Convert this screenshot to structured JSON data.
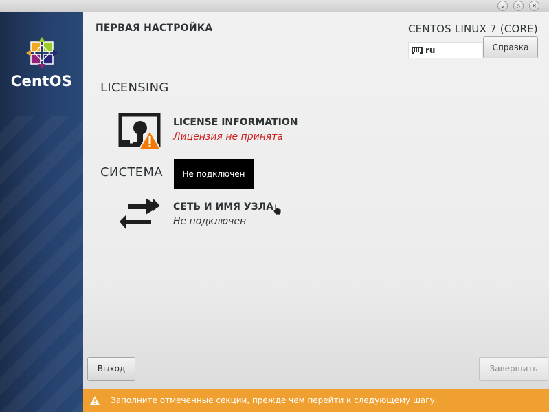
{
  "window": {
    "controls": [
      "minimize",
      "maximize",
      "close"
    ]
  },
  "sidebar": {
    "logo_text": "CentOS"
  },
  "header": {
    "title": "ПЕРВАЯ НАСТРОЙКА",
    "product": "CENTOS LINUX 7 (CORE)",
    "keyboard_layout": "ru",
    "help_label": "Справка"
  },
  "sections": [
    {
      "heading": "LICENSING",
      "spokes": [
        {
          "title": "LICENSE INFORMATION",
          "status": "Лицензия не принята",
          "icon": "license-warning-icon"
        }
      ]
    },
    {
      "heading": "СИСТЕМА",
      "spokes": [
        {
          "title": "СЕТЬ И ИМЯ УЗЛА",
          "status": "Не подключен",
          "icon": "network-arrows-icon"
        }
      ]
    }
  ],
  "tooltip": "Не подключен",
  "buttons": {
    "quit": "Выход",
    "finish": "Завершить"
  },
  "warning": {
    "text": "Заполните отмеченные секции, прежде чем перейти к следующему шагу."
  },
  "colors": {
    "sidebar": "#25406c",
    "warning_bar": "#f0a030",
    "status_warning": "#cc1f1f"
  }
}
